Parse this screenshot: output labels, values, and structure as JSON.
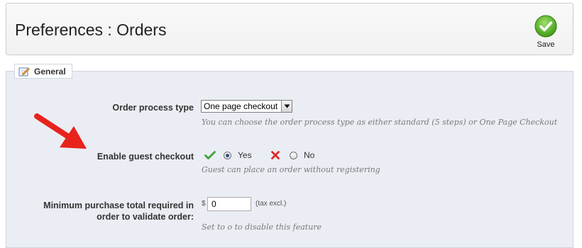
{
  "header": {
    "title": "Preferences : Orders",
    "save_label": "Save"
  },
  "fieldset": {
    "legend": "General",
    "fields": {
      "order_process": {
        "label": "Order process type",
        "selected": "One page checkout",
        "hint": "You can choose the order process type as either standard (5 steps) or One Page Checkout"
      },
      "guest_checkout": {
        "label": "Enable guest checkout",
        "yes_label": "Yes",
        "no_label": "No",
        "selected": "Yes",
        "hint": "Guest can place an order without registering"
      },
      "min_purchase": {
        "label_line1": "Minimum purchase total required in",
        "label_line2": "order to validate order:",
        "currency": "$",
        "value": "0",
        "suffix": "(tax excl.)",
        "hint": "Set to o to disable this feature"
      }
    }
  },
  "colors": {
    "save_green": "#5cb82a",
    "annotation_arrow": "#e8231c",
    "panel_bg": "#ebedf4"
  },
  "icons": [
    "save-check-icon",
    "edit-icon",
    "checkmark-icon",
    "cross-icon",
    "dropdown-arrow-icon",
    "annotation-arrow"
  ]
}
